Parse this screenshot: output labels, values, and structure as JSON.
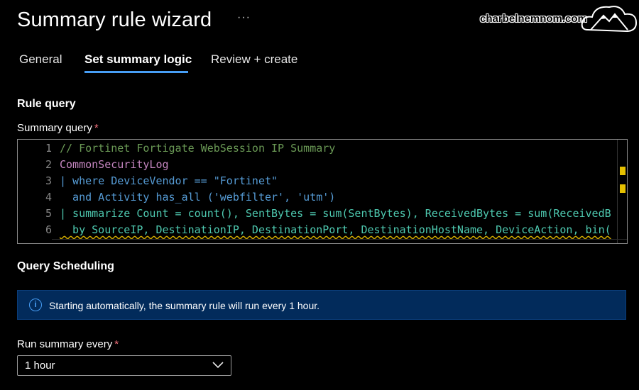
{
  "header": {
    "title": "Summary rule wizard",
    "more_label": "···",
    "watermark": "charbelnemnom.com"
  },
  "tabs": [
    {
      "label": "General",
      "selected": false
    },
    {
      "label": "Set summary logic",
      "selected": true
    },
    {
      "label": "Review + create",
      "selected": false
    }
  ],
  "rule_query": {
    "heading": "Rule query",
    "label": "Summary query",
    "required_mark": "*",
    "lines": [
      {
        "num": "1",
        "text": "// Fortinet Fortigate WebSession IP Summary"
      },
      {
        "num": "2",
        "text": "CommonSecurityLog"
      },
      {
        "num": "3",
        "text": "| where DeviceVendor  == \"Fortinet\""
      },
      {
        "num": "4",
        "text": "  and Activity has_all ('webfilter', 'utm')"
      },
      {
        "num": "5",
        "text": "| summarize Count = count(), SentBytes = sum(SentBytes), ReceivedBytes = sum(ReceivedB"
      },
      {
        "num": "6",
        "text": "  by SourceIP, DestinationIP, DestinationPort, DestinationHostName, DeviceAction, bin("
      }
    ]
  },
  "scheduling": {
    "heading": "Query Scheduling",
    "info_text": "Starting automatically, the summary rule will run every 1 hour.",
    "run_label": "Run summary every",
    "required_mark": "*",
    "run_value": "1 hour"
  },
  "colors": {
    "accent": "#479ef5",
    "info_bg": "#022b5b",
    "required": "#f1707b",
    "comment": "#6a9955",
    "keyword": "#569cd6",
    "string": "#ce9178",
    "identifier": "#4ec9b0",
    "table": "#c586c0"
  },
  "icons": {
    "more": "ellipsis-icon",
    "info": "info-icon",
    "dropdown": "chevron-down-icon",
    "logo": "cloud-mountain-logo"
  }
}
